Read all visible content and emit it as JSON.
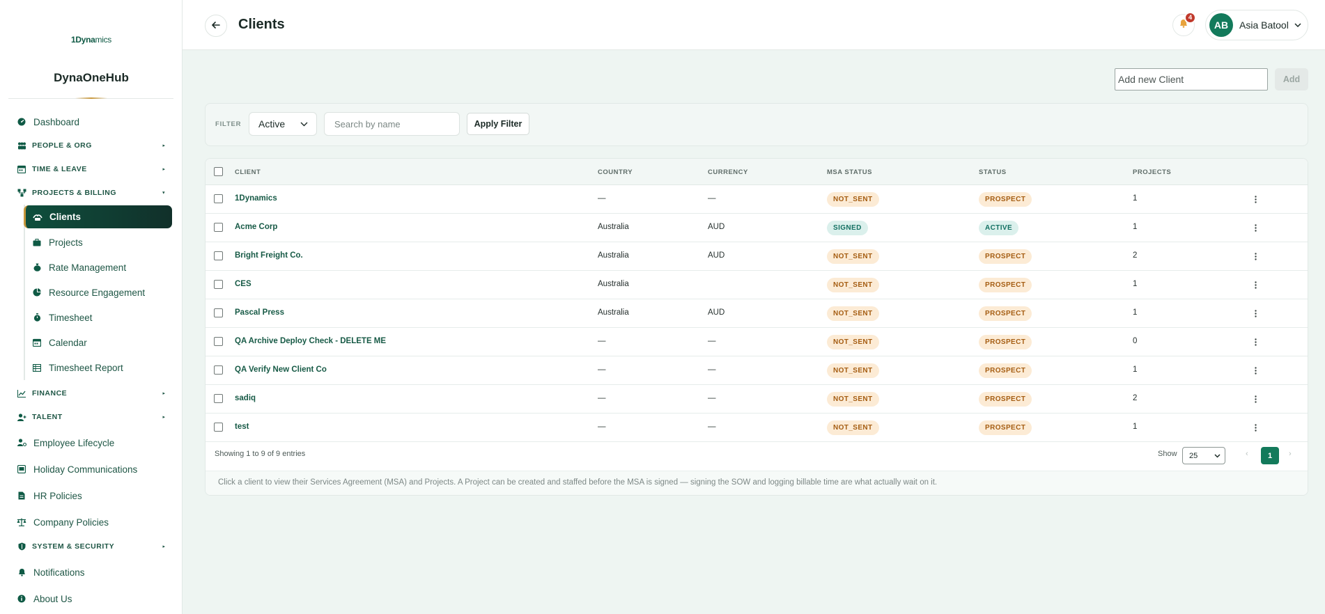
{
  "brand": {
    "logo_bold": "1Dyna",
    "logo_rest": "mics",
    "hub_title": "DynaOneHub"
  },
  "sidebar": {
    "dashboard": "Dashboard",
    "people_org": "PEOPLE & ORG",
    "time_leave": "TIME & LEAVE",
    "projects_billing": "PROJECTS & BILLING",
    "sub_items": [
      "Clients",
      "Projects",
      "Rate Management",
      "Resource Engagement",
      "Timesheet",
      "Calendar",
      "Timesheet Report"
    ],
    "finance": "FINANCE",
    "talent": "TALENT",
    "employee_lifecycle": "Employee Lifecycle",
    "holiday_communications": "Holiday Communications",
    "hr_policies": "HR Policies",
    "company_policies": "Company Policies",
    "system_security": "SYSTEM & SECURITY",
    "notifications": "Notifications",
    "about_us": "About Us",
    "caret": "▸"
  },
  "header": {
    "title": "Clients",
    "notification_count": "4",
    "user_initials": "AB",
    "user_name": "Asia Batool"
  },
  "add_client": {
    "placeholder": "Add new Client",
    "button": "Add"
  },
  "filter": {
    "label": "FILTER",
    "status_value": "Active",
    "search_placeholder": "Search by name",
    "apply_label": "Apply Filter"
  },
  "table": {
    "headers": [
      "CLIENT",
      "COUNTRY",
      "CURRENCY",
      "MSA STATUS",
      "STATUS",
      "PROJECTS"
    ],
    "rows": [
      {
        "client": "1Dynamics",
        "country": "—",
        "currency": "—",
        "msa": "NOT_SENT",
        "status": "PROSPECT",
        "projects": "1"
      },
      {
        "client": "Acme Corp",
        "country": "Australia",
        "currency": "AUD",
        "msa": "SIGNED",
        "status": "ACTIVE",
        "projects": "1"
      },
      {
        "client": "Bright Freight Co.",
        "country": "Australia",
        "currency": "AUD",
        "msa": "NOT_SENT",
        "status": "PROSPECT",
        "projects": "2"
      },
      {
        "client": "CES",
        "country": "Australia",
        "currency": "",
        "msa": "NOT_SENT",
        "status": "PROSPECT",
        "projects": "1"
      },
      {
        "client": "Pascal Press",
        "country": "Australia",
        "currency": "AUD",
        "msa": "NOT_SENT",
        "status": "PROSPECT",
        "projects": "1"
      },
      {
        "client": "QA Archive Deploy Check - DELETE ME",
        "country": "—",
        "currency": "—",
        "msa": "NOT_SENT",
        "status": "PROSPECT",
        "projects": "0"
      },
      {
        "client": "QA Verify New Client Co",
        "country": "—",
        "currency": "—",
        "msa": "NOT_SENT",
        "status": "PROSPECT",
        "projects": "1"
      },
      {
        "client": "sadiq",
        "country": "—",
        "currency": "—",
        "msa": "NOT_SENT",
        "status": "PROSPECT",
        "projects": "2"
      },
      {
        "client": "test",
        "country": "—",
        "currency": "—",
        "msa": "NOT_SENT",
        "status": "PROSPECT",
        "projects": "1"
      }
    ]
  },
  "footer": {
    "info": "Showing 1 to 9 of 9 entries",
    "show_label": "Show",
    "page_size": "25",
    "prev": "‹",
    "current_page": "1",
    "next": "›",
    "hint": "Click a client to view their Services Agreement (MSA) and Projects. A Project can be created and staffed before the MSA is signed — signing the SOW and logging billable time are what actually wait on it."
  },
  "colors": {
    "brand": "#0f5a45",
    "accent_gold": "#c8973c",
    "pill_warn_bg": "#fcebd5",
    "pill_warn_fg": "#a55d12",
    "pill_ok_bg": "#dbf0ec",
    "pill_ok_fg": "#137062",
    "badge": "#c0392b"
  },
  "icons": [
    "dashboard-icon",
    "people-icon",
    "calendar-icon",
    "project-icon",
    "client-icon",
    "briefcase-icon",
    "money-bag-icon",
    "pie-icon",
    "stopwatch-icon",
    "calendar-icon",
    "report-icon",
    "chart-icon",
    "user-plus-icon",
    "user-cycle-icon",
    "mail-icon",
    "document-icon",
    "scales-icon",
    "shield-icon",
    "bell-icon",
    "info-icon",
    "back-arrow-icon",
    "chevron-down-icon",
    "kebab-icon"
  ]
}
